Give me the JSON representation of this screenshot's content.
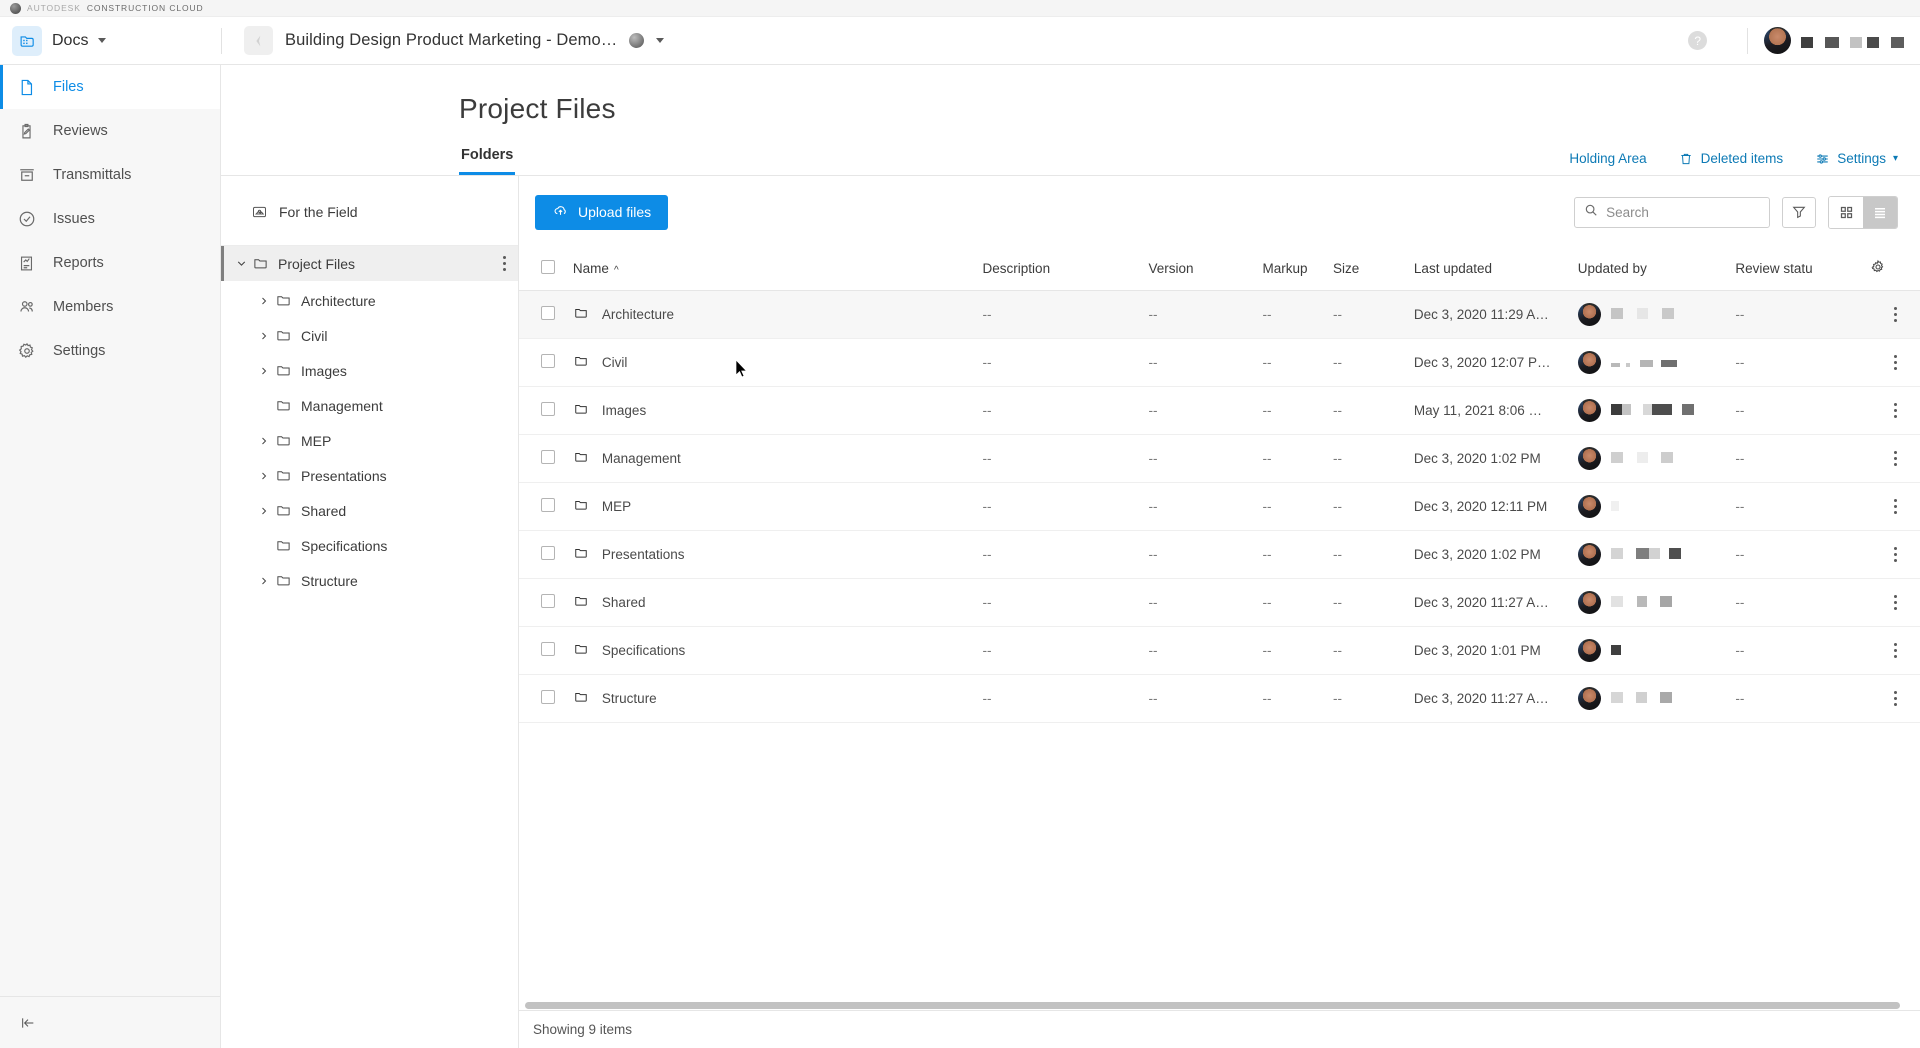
{
  "brand": {
    "autodesk": "AUTODESK",
    "product": "CONSTRUCTION CLOUD"
  },
  "topbar": {
    "app_name": "Docs",
    "project_name": "Building Design Product Marketing - Demo…",
    "help_label": "?"
  },
  "sidebar": {
    "items": [
      {
        "label": "Files",
        "icon": "file-icon",
        "active": true
      },
      {
        "label": "Reviews",
        "icon": "review-icon",
        "active": false
      },
      {
        "label": "Transmittals",
        "icon": "transmittal-icon",
        "active": false
      },
      {
        "label": "Issues",
        "icon": "issue-icon",
        "active": false
      },
      {
        "label": "Reports",
        "icon": "report-icon",
        "active": false
      },
      {
        "label": "Members",
        "icon": "members-icon",
        "active": false
      },
      {
        "label": "Settings",
        "icon": "gear-icon",
        "active": false
      }
    ],
    "collapse_label": "Collapse navigation"
  },
  "page": {
    "title": "Project Files"
  },
  "tabs": {
    "folders": "Folders"
  },
  "header_actions": {
    "holding_area": "Holding Area",
    "deleted_items": "Deleted items",
    "settings": "Settings"
  },
  "tree": {
    "for_the_field": "For the Field",
    "root": {
      "label": "Project Files",
      "expanded": true
    },
    "children": [
      {
        "label": "Architecture",
        "has_children": true
      },
      {
        "label": "Civil",
        "has_children": true
      },
      {
        "label": "Images",
        "has_children": true
      },
      {
        "label": "Management",
        "has_children": false
      },
      {
        "label": "MEP",
        "has_children": true
      },
      {
        "label": "Presentations",
        "has_children": true
      },
      {
        "label": "Shared",
        "has_children": true
      },
      {
        "label": "Specifications",
        "has_children": false
      },
      {
        "label": "Structure",
        "has_children": true
      }
    ]
  },
  "toolbar": {
    "upload_label": "Upload files",
    "search_placeholder": "Search",
    "search_value": "",
    "filter_label": "Filter",
    "grid_view_label": "Grid view",
    "list_view_label": "List view",
    "active_view": "list"
  },
  "table": {
    "columns": [
      "Name",
      "Description",
      "Version",
      "Markup",
      "Size",
      "Last updated",
      "Updated by",
      "Review statu"
    ],
    "sort_column": "Name",
    "sort_direction": "asc",
    "rows": [
      {
        "name": "Architecture",
        "description": "--",
        "version": "--",
        "markup": "--",
        "size": "--",
        "last_updated": "Dec 3, 2020 11:29 A…",
        "updated_by": "",
        "review_status": "--"
      },
      {
        "name": "Civil",
        "description": "--",
        "version": "--",
        "markup": "--",
        "size": "--",
        "last_updated": "Dec 3, 2020 12:07 P…",
        "updated_by": "",
        "review_status": "--"
      },
      {
        "name": "Images",
        "description": "--",
        "version": "--",
        "markup": "--",
        "size": "--",
        "last_updated": "May 11, 2021 8:06 …",
        "updated_by": "",
        "review_status": "--"
      },
      {
        "name": "Management",
        "description": "--",
        "version": "--",
        "markup": "--",
        "size": "--",
        "last_updated": "Dec 3, 2020 1:02 PM",
        "updated_by": "",
        "review_status": "--"
      },
      {
        "name": "MEP",
        "description": "--",
        "version": "--",
        "markup": "--",
        "size": "--",
        "last_updated": "Dec 3, 2020 12:11 PM",
        "updated_by": "",
        "review_status": "--"
      },
      {
        "name": "Presentations",
        "description": "--",
        "version": "--",
        "markup": "--",
        "size": "--",
        "last_updated": "Dec 3, 2020 1:02 PM",
        "updated_by": "",
        "review_status": "--"
      },
      {
        "name": "Shared",
        "description": "--",
        "version": "--",
        "markup": "--",
        "size": "--",
        "last_updated": "Dec 3, 2020 11:27 A…",
        "updated_by": "",
        "review_status": "--"
      },
      {
        "name": "Specifications",
        "description": "--",
        "version": "--",
        "markup": "--",
        "size": "--",
        "last_updated": "Dec 3, 2020 1:01 PM",
        "updated_by": "",
        "review_status": "--"
      },
      {
        "name": "Structure",
        "description": "--",
        "version": "--",
        "markup": "--",
        "size": "--",
        "last_updated": "Dec 3, 2020 11:27 A…",
        "updated_by": "",
        "review_status": "--"
      }
    ]
  },
  "status": {
    "showing": "Showing 9 items"
  },
  "colors": {
    "accent": "#0d8ce6",
    "link": "#0d7ab5",
    "row_hover": "#f7f7f7"
  }
}
